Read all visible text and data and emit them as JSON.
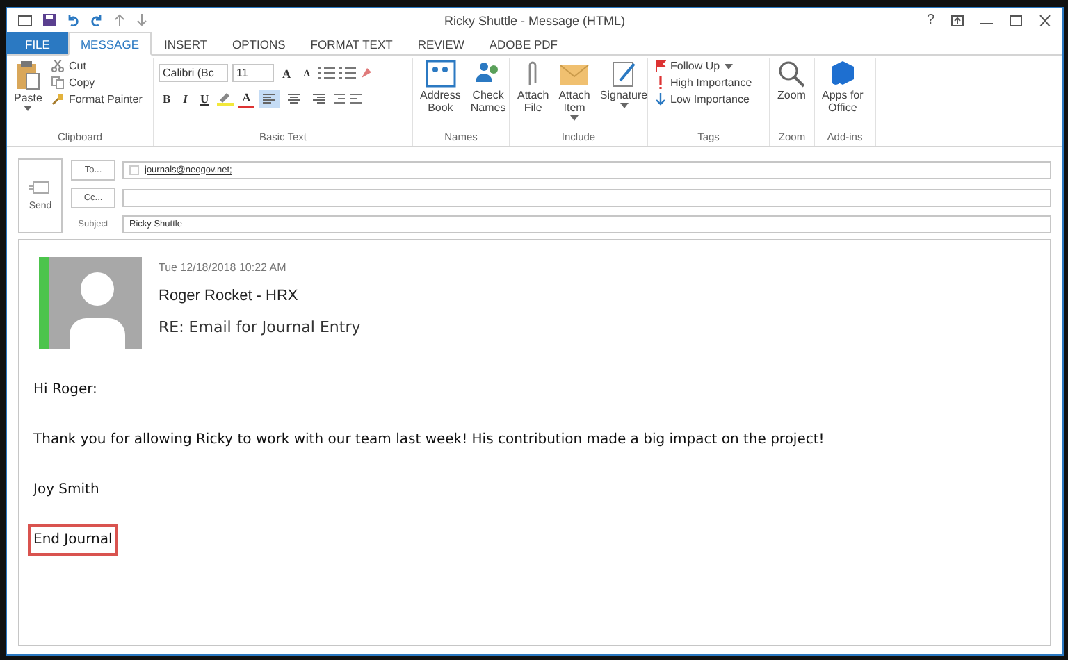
{
  "window": {
    "title": "Ricky Shuttle - Message (HTML)",
    "help": "?"
  },
  "tabs": [
    {
      "label": "FILE",
      "kind": "file",
      "selected": false
    },
    {
      "label": "MESSAGE",
      "kind": "tab",
      "selected": true
    },
    {
      "label": "INSERT",
      "kind": "tab",
      "selected": false
    },
    {
      "label": "OPTIONS",
      "kind": "tab",
      "selected": false
    },
    {
      "label": "FORMAT TEXT",
      "kind": "tab",
      "selected": false
    },
    {
      "label": "REVIEW",
      "kind": "tab",
      "selected": false
    },
    {
      "label": "ADOBE PDF",
      "kind": "tab",
      "selected": false
    }
  ],
  "ribbon": {
    "clipboard": {
      "label": "Clipboard",
      "paste": "Paste",
      "items": [
        "Cut",
        "Copy",
        "Format Painter"
      ]
    },
    "basic_text": {
      "label": "Basic Text",
      "font": "Calibri (Bc",
      "size": "11",
      "styles": [
        "B",
        "I",
        "U"
      ],
      "grow": "A",
      "shrink": "A",
      "color_letter": "A",
      "aligns": [
        {
          "selected": true
        },
        {
          "selected": false
        },
        {
          "selected": false
        }
      ]
    },
    "names": {
      "label": "Names",
      "buttons": [
        "Address\nBook",
        "Check\nNames"
      ]
    },
    "include": {
      "label": "Include",
      "buttons": [
        {
          "label": "Attach\nFile",
          "dropdown": false
        },
        {
          "label": "Attach\nItem",
          "dropdown": true
        },
        {
          "label": "Signature",
          "dropdown": true
        }
      ]
    },
    "tags": {
      "label": "Tags",
      "items": [
        {
          "label": "Follow Up",
          "kind": "flag"
        },
        {
          "label": "High Importance",
          "kind": "high"
        },
        {
          "label": "Low Importance",
          "kind": "low"
        }
      ]
    },
    "zoom": {
      "label": "Zoom",
      "button": "Zoom"
    },
    "addins": {
      "label": "Add-ins",
      "button": "Apps for\nOffice"
    }
  },
  "compose": {
    "send": "Send",
    "to_button": "To...",
    "to_value": "journals@neogov.net;",
    "cc_button": "Cc...",
    "subject_label": "Subject",
    "subject_value": "Ricky Shuttle"
  },
  "message": {
    "date": "Tue 12/18/2018 10:22 AM",
    "sender": "Roger Rocket - HRX",
    "subject": "RE: Email for Journal Entry",
    "paragraphs": [
      {
        "text": "Hi Roger:",
        "highlighted": false
      },
      {
        "text": "Thank you for allowing Ricky to work with our team last week! His contribution made a big impact on the project!",
        "highlighted": false
      },
      {
        "text": "Joy Smith",
        "highlighted": false
      },
      {
        "text": "End Journal",
        "highlighted": true
      }
    ]
  }
}
